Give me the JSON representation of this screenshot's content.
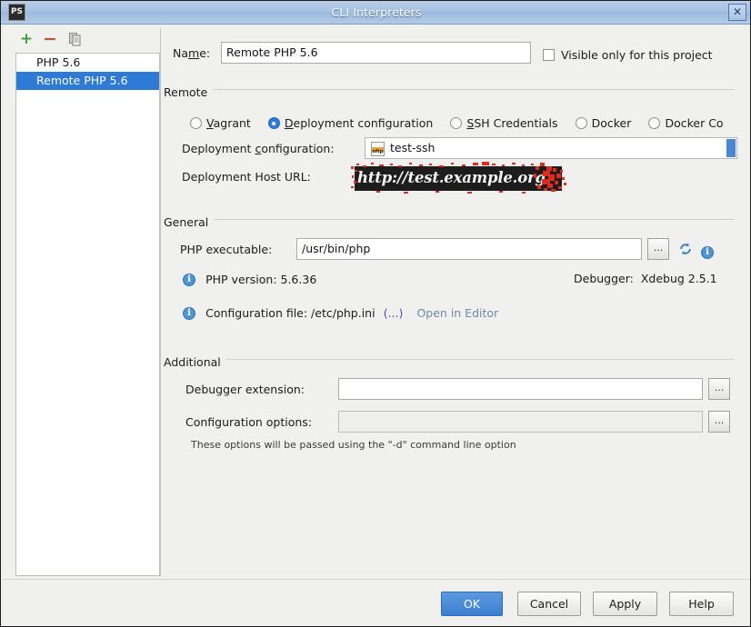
{
  "window": {
    "title": "CLI Interpreters",
    "app_icon_label": "PS",
    "close_icon": "close-icon"
  },
  "sidebar": {
    "toolbar": {
      "add_label": "+",
      "remove_label": "−",
      "copy_label": "copy-icon"
    },
    "items": [
      {
        "label": "PHP 5.6",
        "selected": false
      },
      {
        "label": "Remote PHP 5.6",
        "selected": true
      }
    ]
  },
  "name_row": {
    "label_pre": "Na",
    "label_mnemonic": "m",
    "label_post": "e:",
    "value": "Remote PHP 5.6",
    "visible_only_checkbox": {
      "label": "Visible only for this project",
      "checked": false
    }
  },
  "remote_section": {
    "title": "Remote",
    "radios": [
      {
        "label_pre": "",
        "mnemonic": "V",
        "label_post": "agrant",
        "checked": false
      },
      {
        "label_pre": "",
        "mnemonic": "D",
        "label_post": "eployment configuration",
        "checked": true
      },
      {
        "label_pre": "",
        "mnemonic": "S",
        "label_post": "SH Credentials",
        "checked": false
      },
      {
        "label_pre": "Docker",
        "mnemonic": "",
        "label_post": "",
        "checked": false
      },
      {
        "label_pre": "Docker Co",
        "mnemonic": "",
        "label_post": "",
        "checked": false
      }
    ],
    "deployment_config": {
      "label_pre": "Deployment ",
      "label_mnemonic": "c",
      "label_post": "onfiguration:",
      "value": "test-ssh",
      "icon": "sftp-file-icon"
    },
    "deployment_host_url": {
      "label": "Deployment Host URL:",
      "value": "http://test.example.org",
      "redacted": true
    }
  },
  "general_section": {
    "title": "General",
    "php_executable": {
      "label": "PHP executable:",
      "value": "/usr/bin/php",
      "browse_label": "...",
      "refresh_icon": "refresh-icon",
      "info_icon": "info-icon"
    },
    "php_version": {
      "icon": "info-icon",
      "text": "PHP version: 5.6.36"
    },
    "debugger": {
      "label": "Debugger:",
      "value": "Xdebug 2.5.1"
    },
    "config_file": {
      "icon": "info-icon",
      "text": "Configuration file: /etc/php.ini",
      "paren_link": "(...)",
      "open_link": "Open in Editor"
    }
  },
  "additional_section": {
    "title": "Additional",
    "debugger_extension": {
      "label": "Debugger extension:",
      "value": "",
      "browse_label": "..."
    },
    "configuration_options": {
      "label": "Configuration options:",
      "value": "",
      "browse_label": "...",
      "disabled": true
    },
    "hint": "These options will be passed using the \"-d\" command line option"
  },
  "buttons": {
    "ok": "OK",
    "cancel": "Cancel",
    "apply": "Apply",
    "help": "Help"
  },
  "colors": {
    "accent": "#2d7bd4",
    "titlebar": "#a9c2e2",
    "link": "#7089a8",
    "redaction_bg": "#1d1d1d",
    "scribble": "#e02b1e"
  }
}
